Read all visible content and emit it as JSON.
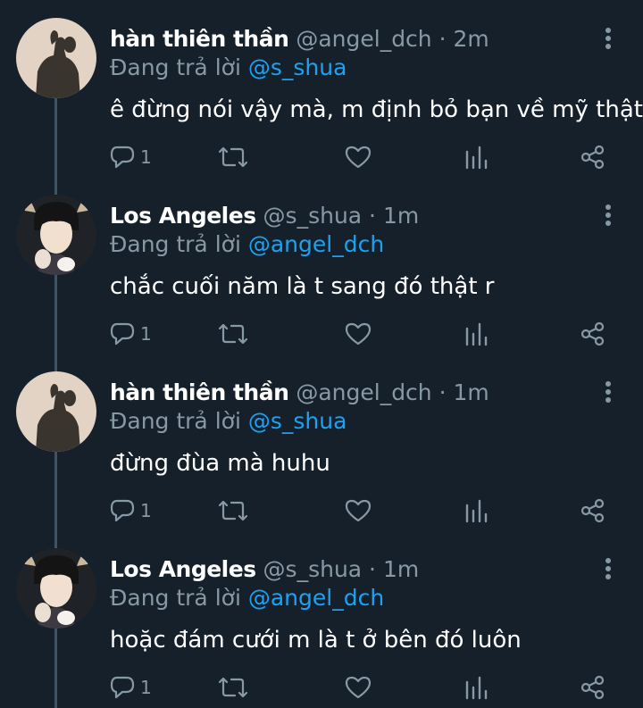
{
  "theme": {
    "background": "#15202b",
    "text": "#ffffff",
    "muted": "#8899a6",
    "link": "#1da1f2",
    "thread_line": "#3d5466"
  },
  "tweets": [
    {
      "name": "hàn thiên thần",
      "handle": "@angel_dch",
      "sep": " · ",
      "time": "2m",
      "reply_prefix": "Đang trả lời ",
      "reply_to": "@s_shua",
      "text": "ê đừng nói vậy mà, m định bỏ bạn về mỹ thật à",
      "reply_count": "1",
      "avatar_icon": "avatar-shadow-photo"
    },
    {
      "name": "Los Angeles",
      "handle": "@s_shua",
      "sep": " · ",
      "time": "1m",
      "reply_prefix": "Đang trả lời ",
      "reply_to": "@angel_dch",
      "text": "chắc cuối năm là t sang đó thật r",
      "reply_count": "1",
      "avatar_icon": "avatar-person-photo"
    },
    {
      "name": "hàn thiên thần",
      "handle": "@angel_dch",
      "sep": " · ",
      "time": "1m",
      "reply_prefix": "Đang trả lời ",
      "reply_to": "@s_shua",
      "text": "đừng đùa mà huhu",
      "reply_count": "1",
      "avatar_icon": "avatar-shadow-photo"
    },
    {
      "name": "Los Angeles",
      "handle": "@s_shua",
      "sep": " · ",
      "time": "1m",
      "reply_prefix": "Đang trả lời ",
      "reply_to": "@angel_dch",
      "text": "hoặc đám cưới m là t ở bên đó luôn",
      "reply_count": "1",
      "avatar_icon": "avatar-person-photo"
    }
  ],
  "icons": {
    "reply": "reply-icon",
    "retweet": "retweet-icon",
    "like": "heart-icon",
    "analytics": "analytics-icon",
    "share": "share-icon",
    "more": "more-vertical-icon"
  }
}
